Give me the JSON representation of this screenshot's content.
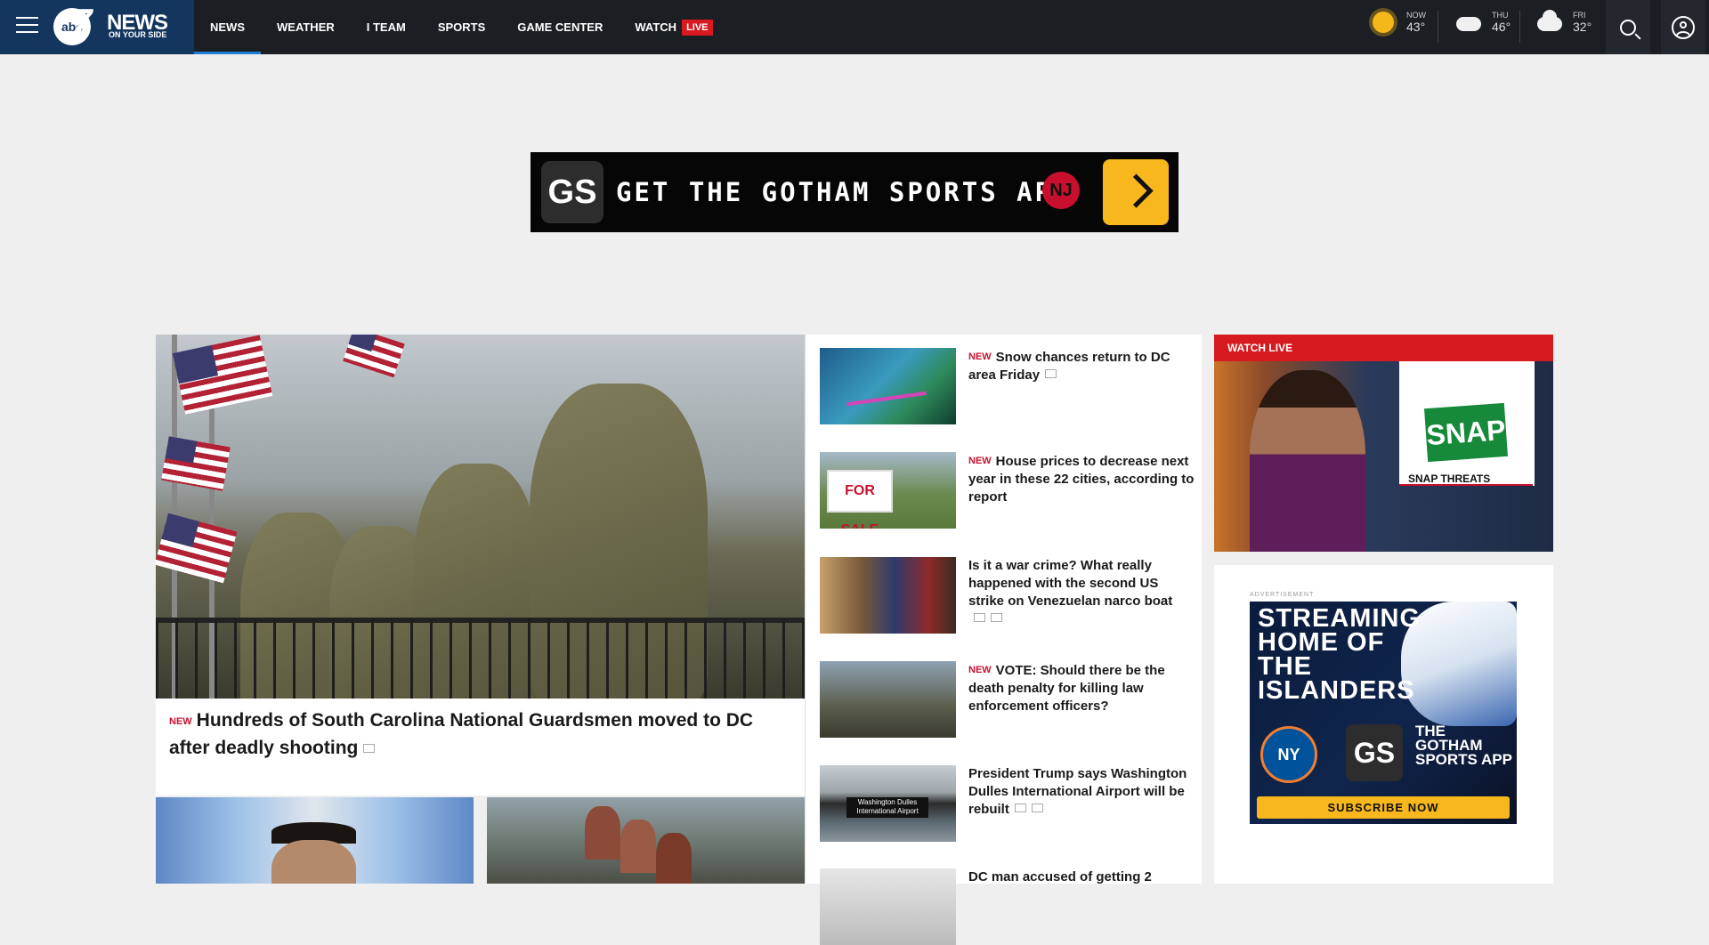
{
  "header": {
    "logo_text": "abc7 NEWS ON YOUR SIDE",
    "nav": [
      {
        "label": "NEWS"
      },
      {
        "label": "WEATHER"
      },
      {
        "label": "I TEAM"
      },
      {
        "label": "SPORTS"
      },
      {
        "label": "GAME CENTER"
      },
      {
        "label": "WATCH"
      }
    ],
    "live_badge": "LIVE",
    "weather": [
      {
        "label": "NOW",
        "temp": "43°",
        "icon": "sun-icon"
      },
      {
        "label": "THU",
        "temp": "46°",
        "icon": "partly-cloudy-icon"
      },
      {
        "label": "FRI",
        "temp": "32°",
        "icon": "cloud-icon"
      }
    ]
  },
  "banner_ad": {
    "badge": "GS",
    "text": "GET THE GOTHAM SPORTS APP"
  },
  "lead": {
    "new_tag": "NEW",
    "headline": "Hundreds of South Carolina National Guardsmen moved to DC after deadly shooting"
  },
  "stories": [
    {
      "new_tag": "NEW",
      "title": "Snow chances return to DC area Friday"
    },
    {
      "new_tag": "NEW",
      "title": "House prices to decrease next year in these 22 cities, according to report",
      "thumb_text": "FOR SALE"
    },
    {
      "new_tag": "",
      "title": "Is it a war crime? What really happened with the second US strike on Venezuelan narco boat"
    },
    {
      "new_tag": "NEW",
      "title": "VOTE: Should there be the death penalty for killing law enforcement officers?"
    },
    {
      "new_tag": "",
      "title": "President Trump says Washington Dulles International Airport will be rebuilt",
      "thumb_text": "Washington Dulles International Airport"
    },
    {
      "new_tag": "",
      "title": "DC man accused of getting 2"
    }
  ],
  "watch_live": {
    "label": "WATCH LIVE",
    "graphic_logo": "SNAP",
    "graphic_caption": "SNAP THREATS"
  },
  "side_ad": {
    "label": "ADVERTISEMENT",
    "headline": "STREAMING HOME OF THE ISLANDERS",
    "team_badge": "NY",
    "app_badge": "GS",
    "app_text": "THE GOTHAM SPORTS APP",
    "cta": "SUBSCRIBE NOW"
  },
  "colors": {
    "nav_bg": "#1b1e23",
    "brand_bg": "#13355e",
    "accent_red": "#d71920",
    "page_bg": "#efefef"
  }
}
